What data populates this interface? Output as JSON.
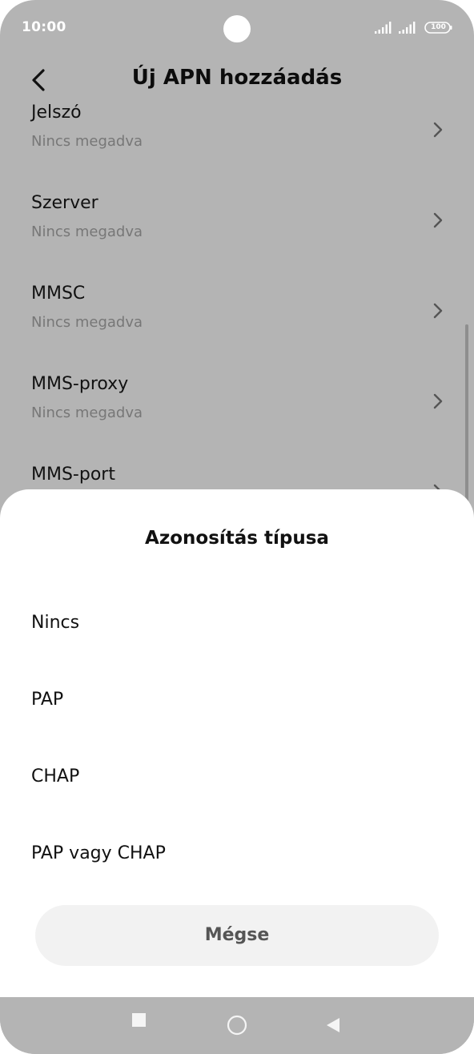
{
  "status_bar": {
    "time": "10:00",
    "battery_level": "100",
    "icons": [
      "signal-icon",
      "signal-icon",
      "battery-icon"
    ]
  },
  "header": {
    "title": "Új APN hozzáadás",
    "back_icon": "chevron-left-icon"
  },
  "settings": [
    {
      "title": "Jelszó",
      "value": "Nincs megadva"
    },
    {
      "title": "Szerver",
      "value": "Nincs megadva"
    },
    {
      "title": "MMSC",
      "value": "Nincs megadva"
    },
    {
      "title": "MMS-proxy",
      "value": "Nincs megadva"
    },
    {
      "title": "MMS-port",
      "value": ""
    }
  ],
  "sheet": {
    "title": "Azonosítás típusa",
    "options": [
      {
        "label": "Nincs"
      },
      {
        "label": "PAP"
      },
      {
        "label": "CHAP"
      },
      {
        "label": "PAP vagy CHAP"
      }
    ],
    "cancel_label": "Mégse"
  },
  "nav_bar": {
    "icons": [
      "recents-square-icon",
      "home-circle-icon",
      "back-triangle-icon"
    ]
  },
  "colors": {
    "scrim": "#b4b4b4",
    "sheet_background": "#ffffff",
    "cancel_background": "#f2f2f2",
    "primary_text": "#111111",
    "secondary_text": "#777777"
  }
}
